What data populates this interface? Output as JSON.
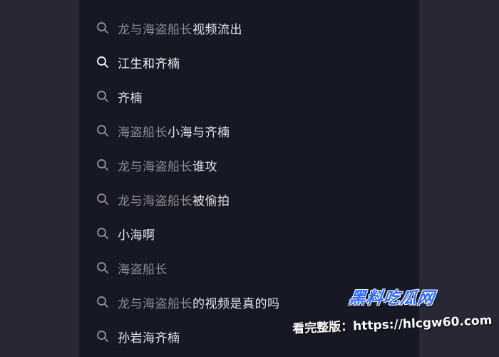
{
  "colors": {
    "page_background": "#272833",
    "panel_background": "#161823",
    "query_text": "#8d8e96",
    "rest_text": "#e4e5ea",
    "watermark_logo": "#2b6bff"
  },
  "icon": "search-icon",
  "suggestions": [
    {
      "query": "龙与海盗船长",
      "rest": "视频流出",
      "active": false
    },
    {
      "query": "",
      "rest": "江生和齐楠",
      "active": true
    },
    {
      "query": "",
      "rest": "齐楠",
      "active": false
    },
    {
      "query": "海盗船长",
      "rest": "小海与齐楠",
      "active": false
    },
    {
      "query": "龙与海盗船长",
      "rest": "谁攻",
      "active": false
    },
    {
      "query": "龙与海盗船长",
      "rest": "被偷拍",
      "active": false
    },
    {
      "query": "",
      "rest": "小海啊",
      "active": false
    },
    {
      "query": "海盗船长",
      "rest": "",
      "active": false
    },
    {
      "query": "龙与海盗船长",
      "rest": "的视频是真的吗",
      "active": false
    },
    {
      "query": "",
      "rest": "孙岩海齐楠",
      "active": false
    }
  ],
  "watermark": {
    "logo": "黑料吃瓜网",
    "line": "看完整版：https://hlcgw60.com"
  }
}
